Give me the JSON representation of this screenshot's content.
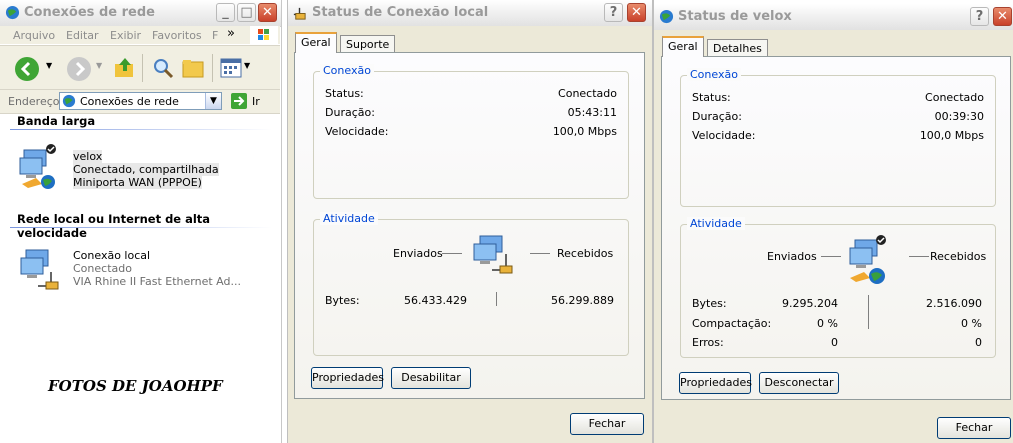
{
  "explorer": {
    "title": "Conexões de rede",
    "menu": [
      "Arquivo",
      "Editar",
      "Exibir",
      "Favoritos",
      "F"
    ],
    "menu_more": "»",
    "address_label": "Endereço",
    "address_value": "Conexões de rede",
    "go_label": "Ir",
    "section_broadband": "Banda larga",
    "section_lan": "Rede local ou Internet de alta velocidade",
    "connections": [
      {
        "name": "velox",
        "status": "Conectado, compartilhada",
        "device": "Miniporta WAN (PPPOE)"
      },
      {
        "name": "Conexão local",
        "status": "Conectado",
        "device": "VIA Rhine II Fast Ethernet Ad..."
      }
    ],
    "watermark": "FOTOS DE JOAOHPF"
  },
  "local_status": {
    "title": "Status de Conexão local",
    "tabs": [
      "Geral",
      "Suporte"
    ],
    "connection_group": "Conexão",
    "status_label": "Status:",
    "status_value": "Conectado",
    "duration_label": "Duração:",
    "duration_value": "05:43:11",
    "speed_label": "Velocidade:",
    "speed_value": "100,0 Mbps",
    "activity_group": "Atividade",
    "sent_label": "Enviados",
    "received_label": "Recebidos",
    "bytes_label": "Bytes:",
    "bytes_sent": "56.433.429",
    "bytes_received": "56.299.889",
    "properties_button": "Propriedades",
    "disable_button": "Desabilitar",
    "close_button": "Fechar"
  },
  "velox_status": {
    "title": "Status de velox",
    "tabs": [
      "Geral",
      "Detalhes"
    ],
    "connection_group": "Conexão",
    "status_label": "Status:",
    "status_value": "Conectado",
    "duration_label": "Duração:",
    "duration_value": "00:39:30",
    "speed_label": "Velocidade:",
    "speed_value": "100,0 Mbps",
    "activity_group": "Atividade",
    "sent_label": "Enviados",
    "received_label": "Recebidos",
    "bytes_label": "Bytes:",
    "bytes_sent": "9.295.204",
    "bytes_received": "2.516.090",
    "compression_label": "Compactação:",
    "compression_sent": "0 %",
    "compression_received": "0 %",
    "errors_label": "Erros:",
    "errors_sent": "0",
    "errors_received": "0",
    "properties_button": "Propriedades",
    "disconnect_button": "Desconectar",
    "close_button": "Fechar"
  }
}
